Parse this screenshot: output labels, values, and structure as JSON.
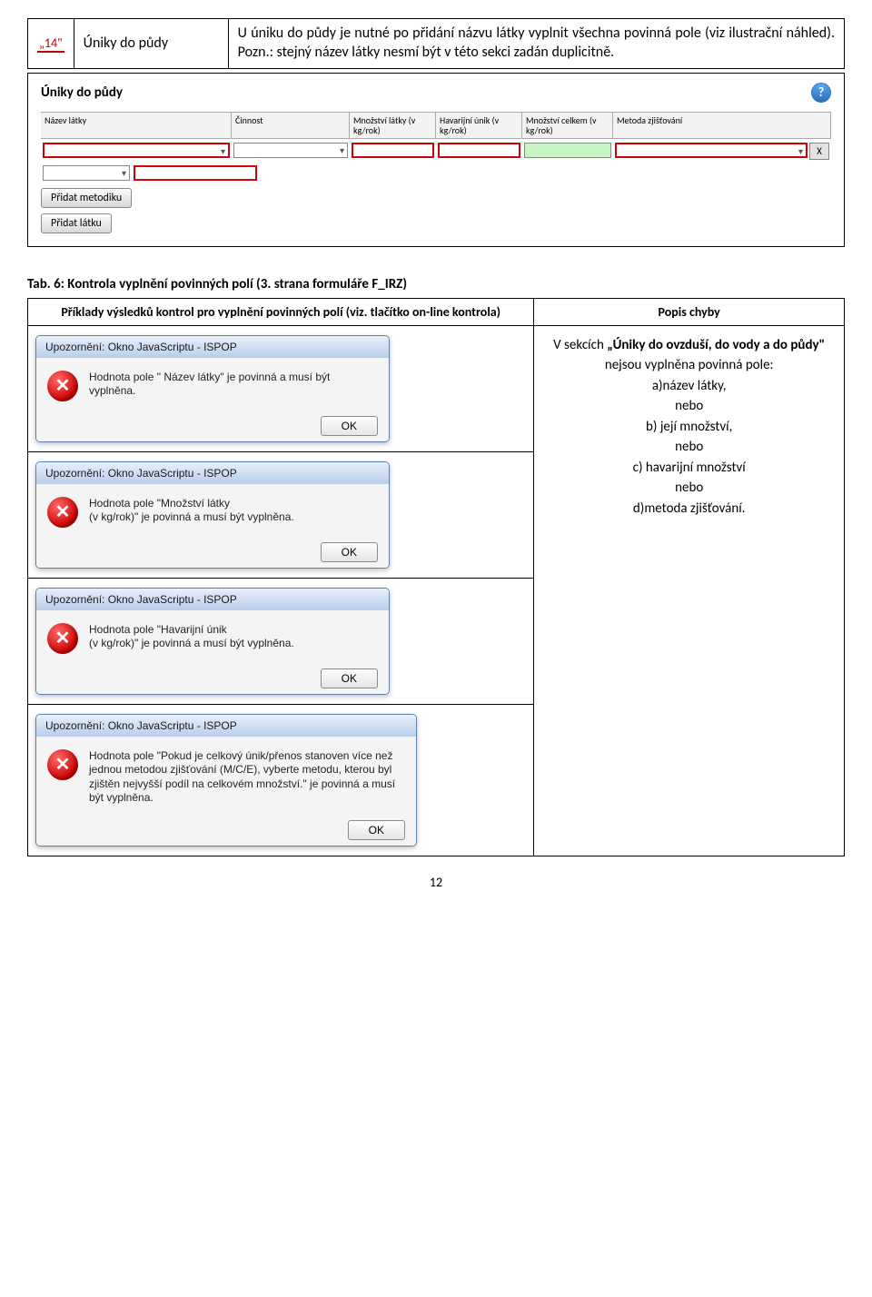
{
  "topTable": {
    "num": "„14\"",
    "title": "Úniky do půdy",
    "desc": "U úniku do půdy je nutné po přidání názvu látky vyplnit všechna povinná pole (viz ilustrační náhled). Pozn.: stejný název látky nesmí být v této sekci zadán duplicitně."
  },
  "screenshot": {
    "title": "Úniky do půdy",
    "headers": [
      "Název látky",
      "Činnost",
      "Množství látky (v kg/rok)",
      "Havarijní únik (v kg/rok)",
      "Množství celkem (v kg/rok)",
      "Metoda zjišťování"
    ],
    "btnMetodika": "Přidat metodiku",
    "btnLatka": "Přidat látku",
    "rowX": "X"
  },
  "caption": "Tab. 6: Kontrola vyplnění povinných polí (3. strana formuláře F_IRZ)",
  "exHeaders": {
    "left": "Příklady výsledků kontrol pro vyplnění povinných polí (viz. tlačítko on-line kontrola)",
    "right": "Popis chyby"
  },
  "dialogTitle": "Upozornění: Okno JavaScriptu - ISPOP",
  "dialogs": [
    "Hodnota pole \" Název látky\" je povinná a musí být vyplněna.",
    "Hodnota pole \"Množství látky\n(v kg/rok)\" je povinná a musí být vyplněna.",
    "Hodnota pole \"Havarijní únik\n(v kg/rok)\" je povinná a musí být vyplněna.",
    "Hodnota pole \"Pokud je celkový únik/přenos stanoven více než jednou metodou zjišťování (M/C/E), vyberte metodu, kterou byl zjištěn nejvyšší podíl na celkovém množství.\" je povinná a musí být vyplněna."
  ],
  "okLabel": "OK",
  "errorDesc": {
    "line1a": "V sekcích ",
    "bold": "„Úniky do ovzduší, do vody a do půdy\"",
    "line1b": " nejsou vyplněna povinná pole:",
    "a": "a)název látky,",
    "nebo": "nebo",
    "b": "b) její množství,",
    "c": "c) havarijní množství",
    "d": "d)metoda zjišťování."
  },
  "pageNum": "12"
}
